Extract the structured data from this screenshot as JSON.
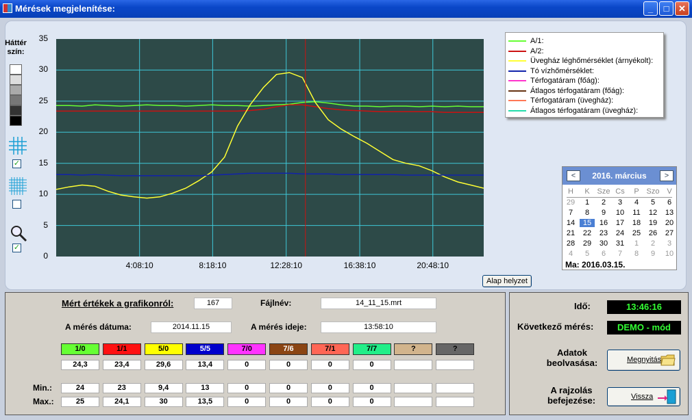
{
  "window": {
    "title": "Mérések megjelenítése:"
  },
  "side": {
    "bg_label_1": "Háttér",
    "bg_label_2": "szín:",
    "grid_checked": "✓",
    "dense_grid_checked": "",
    "zoom_checked": "✓"
  },
  "chart_data": {
    "type": "line",
    "y_ticks": [
      "35",
      "30",
      "25",
      "20",
      "15",
      "10",
      "5",
      "0"
    ],
    "x_ticks": [
      "4:08:10",
      "8:18:10",
      "12:28:10",
      "16:38:10",
      "20:48:10"
    ],
    "ylim": [
      0,
      35
    ],
    "grid": true,
    "background": "#2d4a48",
    "cursor_x_label": "13:58:10",
    "series": [
      {
        "name": "A/1:",
        "color": "#66ff33",
        "values": [
          24.3,
          24.3,
          24.2,
          24.4,
          24.3,
          24.2,
          24.3,
          24.4,
          24.3,
          24.3,
          24.2,
          24.3,
          24.4,
          24.3,
          24.3,
          24.2,
          24.3,
          24.4,
          24.5,
          24.8,
          24.9,
          24.7,
          24.4,
          24.2,
          24.2,
          24.1,
          24.2,
          24.2,
          24.1,
          24.2,
          24.1,
          24.2,
          24.1,
          24.1
        ]
      },
      {
        "name": "A/2:",
        "color": "#cc1111",
        "values": [
          23.4,
          23.4,
          23.4,
          23.4,
          23.4,
          23.4,
          23.4,
          23.4,
          23.4,
          23.4,
          23.4,
          23.4,
          23.4,
          23.4,
          23.4,
          23.5,
          23.7,
          24.1,
          24.4,
          24.4,
          24.1,
          23.8,
          23.6,
          23.5,
          23.4,
          23.3,
          23.3,
          23.3,
          23.3,
          23.3,
          23.2,
          23.2,
          23.2,
          23.2
        ]
      },
      {
        "name": "Üvegház léghőmérséklet (árnyékolt):",
        "color": "#ffff33",
        "values": [
          10.8,
          11.2,
          11.5,
          11.3,
          10.5,
          9.9,
          9.6,
          9.4,
          9.6,
          10.2,
          11.0,
          12.2,
          13.6,
          16.0,
          21.0,
          24.5,
          27.2,
          29.3,
          29.6,
          28.8,
          24.8,
          22.0,
          20.5,
          19.3,
          18.2,
          16.9,
          15.6,
          15.0,
          14.6,
          13.8,
          12.8,
          12.0,
          11.5,
          11.0
        ]
      },
      {
        "name": "Tó vízhőmérséklet:",
        "color": "#1122aa",
        "values": [
          13.2,
          13.2,
          13.1,
          13.2,
          13.1,
          13.0,
          13.0,
          13.0,
          13.0,
          13.0,
          13.0,
          13.0,
          13.1,
          13.2,
          13.3,
          13.4,
          13.4,
          13.4,
          13.4,
          13.3,
          13.3,
          13.3,
          13.2,
          13.2,
          13.2,
          13.2,
          13.2,
          13.1,
          13.1,
          13.1,
          13.1,
          13.1,
          13.1,
          13.1
        ]
      },
      {
        "name": "Térfogatáram (főág):",
        "color": "#ff33cc",
        "values": []
      },
      {
        "name": "Átlagos térfogatáram (főág):",
        "color": "#663311",
        "values": []
      },
      {
        "name": "Térfogatáram (üvegház):",
        "color": "#ff7755",
        "values": []
      },
      {
        "name": "Átlagos térfogatáram (üvegház):",
        "color": "#22ddaa",
        "values": []
      }
    ]
  },
  "calendar": {
    "month_label": "2016. március",
    "prev": "<",
    "next": ">",
    "weekdays": [
      "H",
      "K",
      "Sze",
      "Cs",
      "P",
      "Szo",
      "V"
    ],
    "days": [
      "29",
      "1",
      "2",
      "3",
      "4",
      "5",
      "6",
      "7",
      "8",
      "9",
      "10",
      "11",
      "12",
      "13",
      "14",
      "15",
      "16",
      "17",
      "18",
      "19",
      "20",
      "21",
      "22",
      "23",
      "24",
      "25",
      "26",
      "27",
      "28",
      "29",
      "30",
      "31",
      "1",
      "2",
      "3",
      "4",
      "5",
      "6",
      "7",
      "8",
      "9",
      "10"
    ],
    "today_label": "Ma:",
    "today_value": "2016.03.15."
  },
  "reset_button": "Alap helyzet",
  "values_panel": {
    "heading": "Mért értékek a grafikonról:",
    "count": "167",
    "filename_label": "Fájlnév:",
    "filename": "14_11_15.mrt",
    "date_label": "A mérés dátuma:",
    "date": "2014.11.15",
    "time_label": "A mérés ideje:",
    "time": "13:58:10",
    "chips": [
      {
        "label": "1/0",
        "color": "#66ff33"
      },
      {
        "label": "1/1",
        "color": "#ff1111"
      },
      {
        "label": "5/0",
        "color": "#ffff00"
      },
      {
        "label": "5/5",
        "color": "#0000cc",
        "text": "#ffffff"
      },
      {
        "label": "7/0",
        "color": "#ff33ff"
      },
      {
        "label": "7/6",
        "color": "#8b4513",
        "text": "#ffffff"
      },
      {
        "label": "7/1",
        "color": "#ff6655"
      },
      {
        "label": "7/7",
        "color": "#22ee88"
      },
      {
        "label": "?",
        "color": "#d2b48c"
      },
      {
        "label": "?",
        "color": "#666666"
      }
    ],
    "current": [
      "24,3",
      "23,4",
      "29,6",
      "13,4",
      "0",
      "0",
      "0",
      "0",
      "",
      ""
    ],
    "min_label": "Min.:",
    "max_label": "Max.:",
    "min": [
      "24",
      "23",
      "9,4",
      "13",
      "0",
      "0",
      "0",
      "0",
      "",
      ""
    ],
    "max": [
      "25",
      "24,1",
      "30",
      "13,5",
      "0",
      "0",
      "0",
      "0",
      "",
      ""
    ]
  },
  "status_panel": {
    "time_label": "Idő:",
    "time_value": "13:46:16",
    "next_label": "Következő mérés:",
    "next_value": "DEMO - mód",
    "read_label_1": "Adatok",
    "read_label_2": "beolvasása:",
    "open_button": "Megnyitás",
    "finish_label_1": "A rajzolás",
    "finish_label_2": "befejezése:",
    "back_button": "Vissza"
  }
}
